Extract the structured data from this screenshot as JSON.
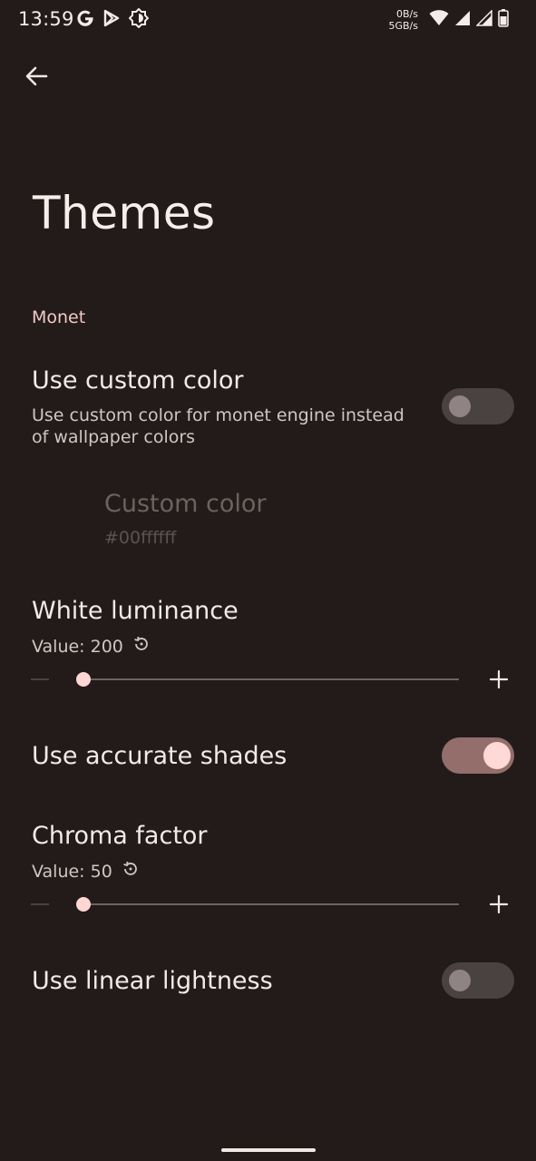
{
  "status_bar": {
    "time": "13:59",
    "net_up": "0B/s",
    "net_down": "5GB/s",
    "icons": [
      "google-icon",
      "play-store-icon",
      "brightness-icon",
      "wifi-icon",
      "signal-icon",
      "signal-icon",
      "battery-icon"
    ]
  },
  "page": {
    "title": "Themes"
  },
  "section": {
    "label": "Monet"
  },
  "custom_color_toggle": {
    "title": "Use custom color",
    "summary_line1": "Use custom color for monet engine instead",
    "summary_line2": "of wallpaper colors",
    "enabled": false
  },
  "custom_color": {
    "title": "Custom color",
    "value": "#00ffffff"
  },
  "white_luminance": {
    "title": "White luminance",
    "value_text": "Value: 200",
    "slider_fraction": 0.0
  },
  "accurate_shades": {
    "title": "Use accurate shades",
    "enabled": true
  },
  "chroma_factor": {
    "title": "Chroma factor",
    "value_text": "Value: 50",
    "slider_fraction": 0.0
  },
  "linear_lightness": {
    "title": "Use linear lightness",
    "enabled": false
  },
  "colors": {
    "background": "#221b1a",
    "accent": "#f2c9c5",
    "switch_on_track": "#936e6b",
    "switch_on_thumb": "#ffd9d6"
  }
}
